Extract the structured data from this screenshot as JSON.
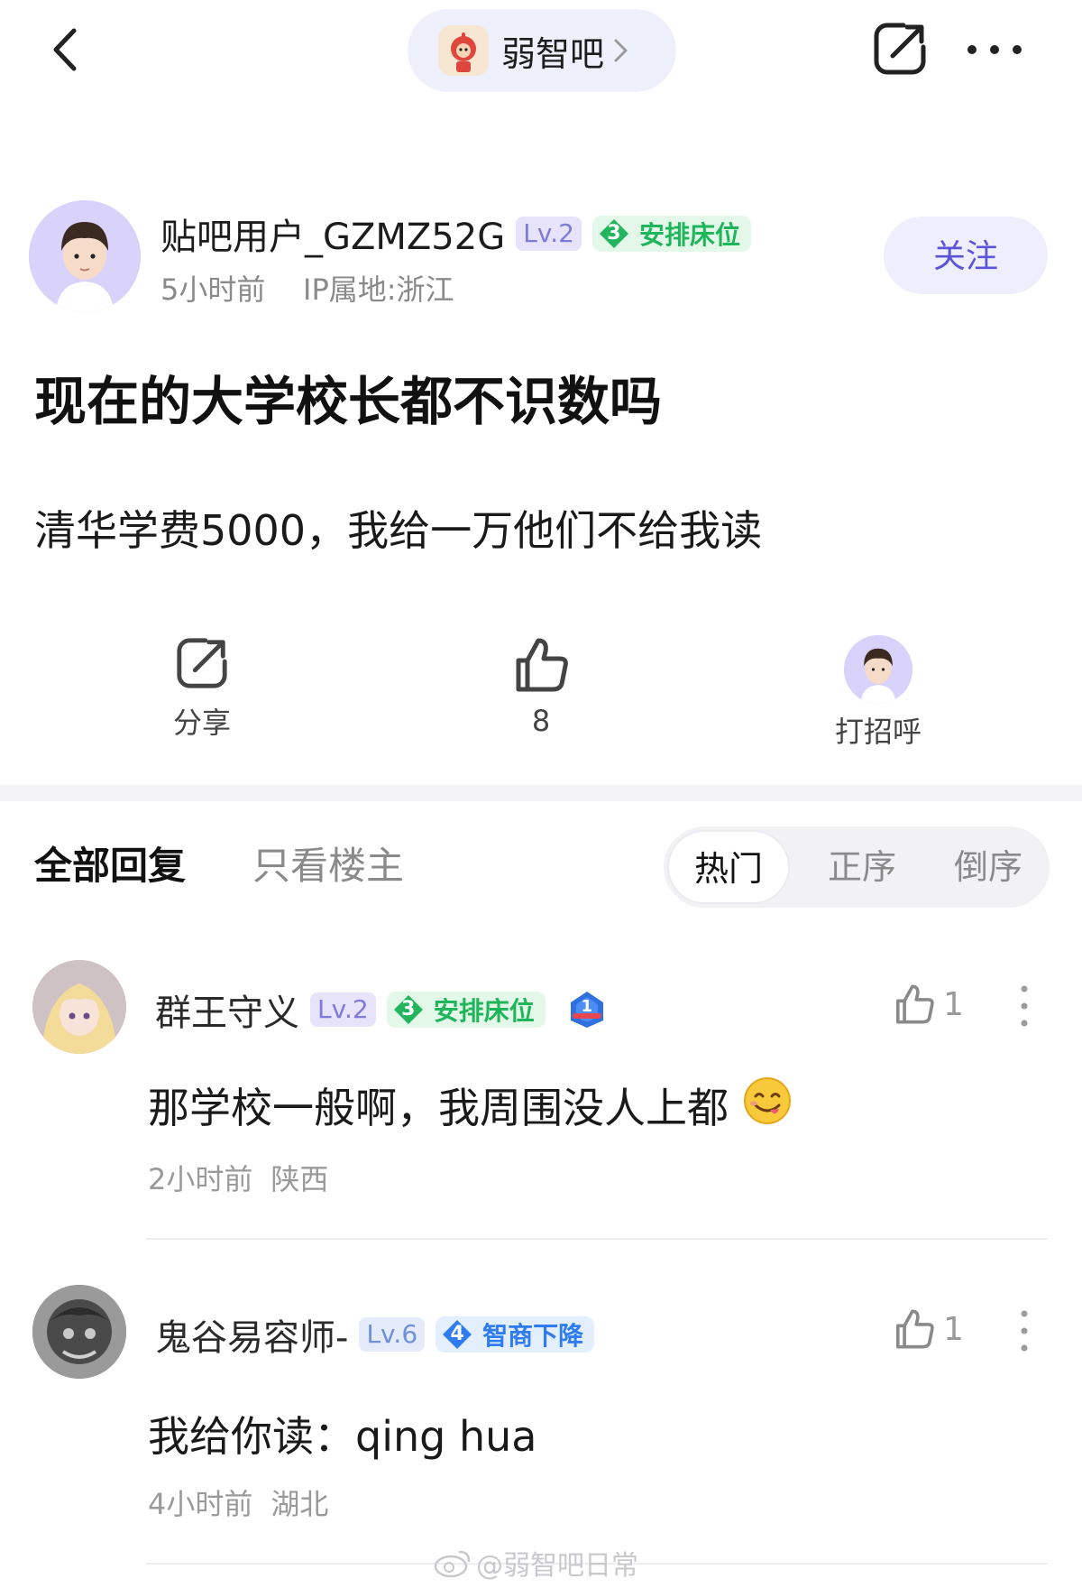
{
  "topbar": {
    "forum_name": "弱智吧",
    "icons": [
      "back-arrow-icon",
      "chevron-right-icon",
      "share-icon",
      "more-icon"
    ]
  },
  "post": {
    "author": {
      "name": "贴吧用户_GZMZ52G",
      "level": "Lv.2",
      "honor_rank": "3",
      "honor_title": "安排床位",
      "time": "5小时前",
      "ip": "IP属地:浙江"
    },
    "follow_label": "关注",
    "title": "现在的大学校长都不识数吗",
    "body": "清华学费5000，我给一万他们不给我读",
    "actions": {
      "share_label": "分享",
      "like_count": "8",
      "greet_label": "打招呼"
    }
  },
  "tabs": {
    "all_replies": "全部回复",
    "op_only": "只看楼主",
    "sort": [
      "热门",
      "正序",
      "倒序"
    ],
    "active_sort": "热门"
  },
  "comments": [
    {
      "name": "群王守义",
      "level": "Lv.2",
      "honor_rank": "3",
      "honor_title": "安排床位",
      "extra_badge_rank": "1",
      "text": "那学校一般啊，我周围没人上都",
      "emoji": "😋",
      "time": "2小时前",
      "location": "陕西",
      "likes": "1"
    },
    {
      "name": "鬼谷易容师-",
      "level": "Lv.6",
      "honor_rank": "4",
      "honor_title": "智商下降",
      "text": "我给你读：qing hua",
      "time": "4小时前",
      "location": "湖北",
      "likes": "1"
    }
  ],
  "watermark": "@弱智吧日常",
  "colors": {
    "accent": "#5b55d6",
    "level_badge_bg": "#e6e3fb",
    "honor_green": "#1fb55a",
    "honor_blue": "#2f7cf0"
  }
}
